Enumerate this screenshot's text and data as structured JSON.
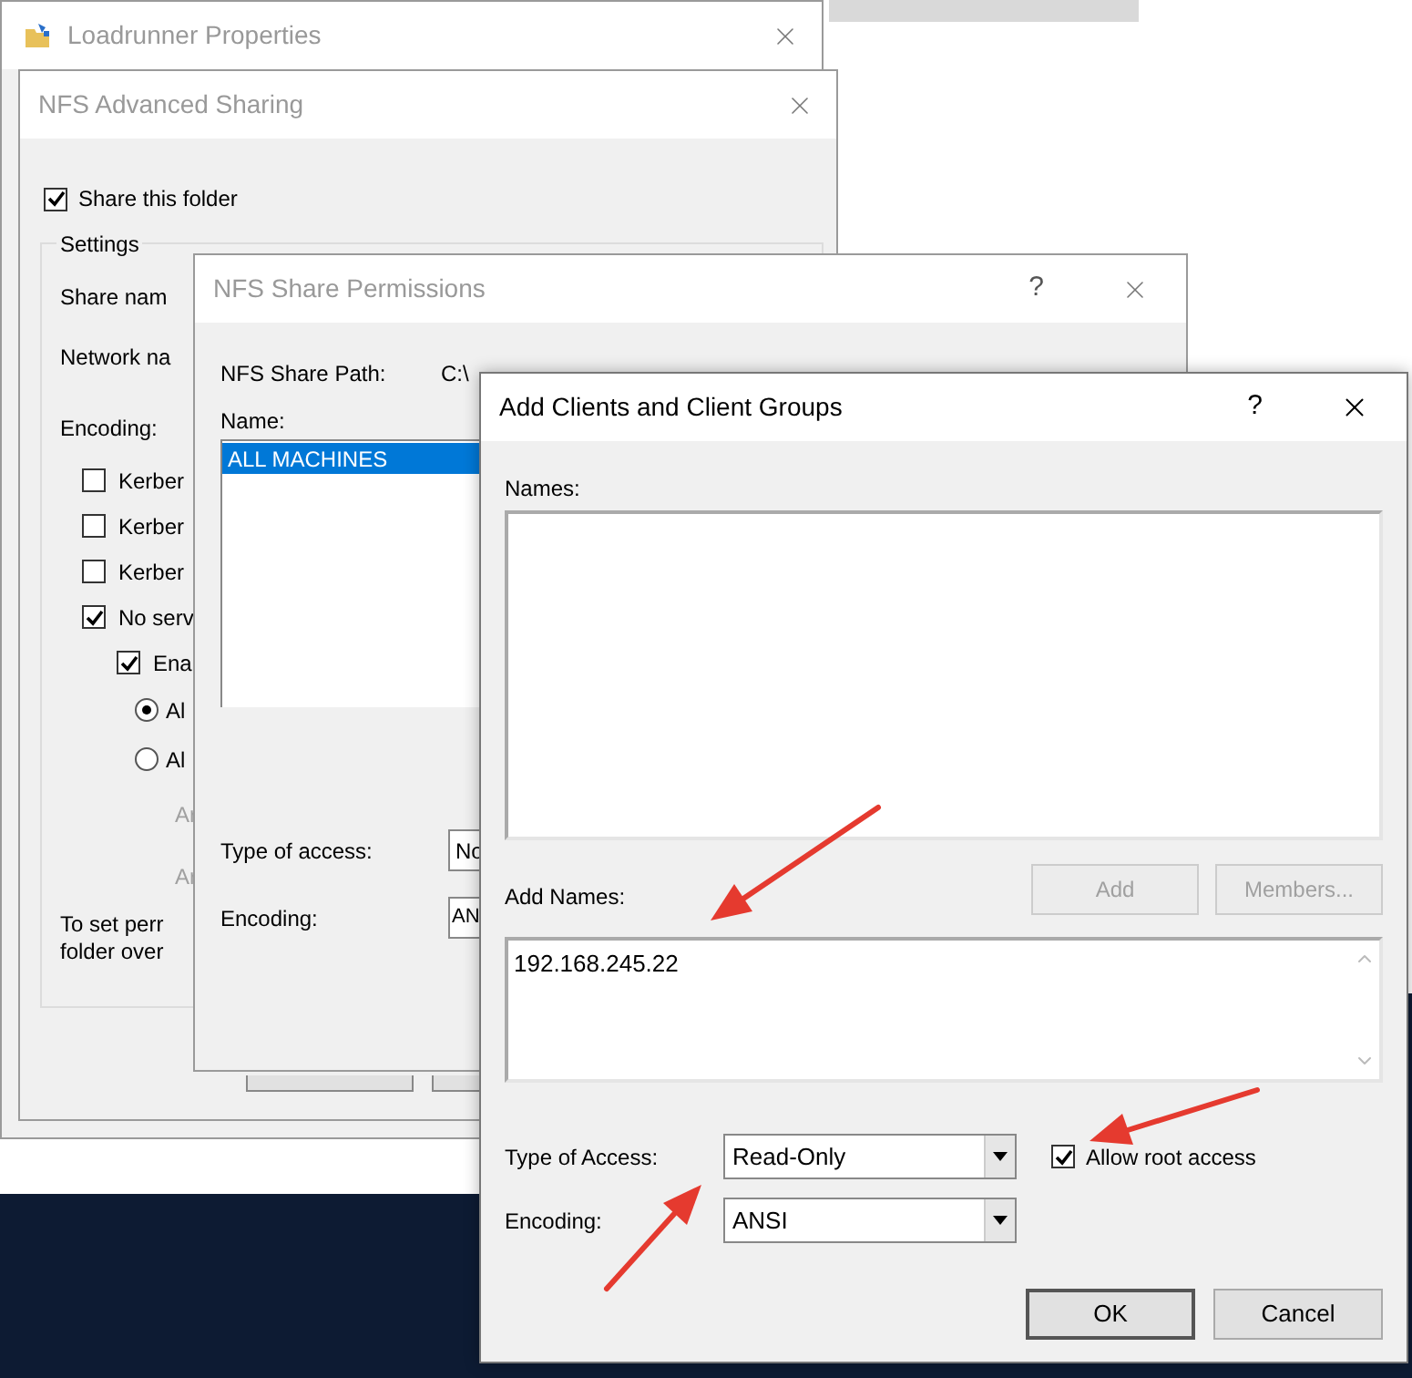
{
  "background_window": {
    "title": "Loadrunner Properties"
  },
  "advanced_sharing": {
    "title": "NFS Advanced Sharing",
    "share_folder": {
      "label": "Share this folder",
      "checked": true
    },
    "settings_label": "Settings",
    "labels": [
      "Share nam",
      "Network na",
      "Encoding:"
    ],
    "options": [
      {
        "kind": "checkbox",
        "label": "Kerber",
        "checked": false
      },
      {
        "kind": "checkbox",
        "label": "Kerber",
        "checked": false
      },
      {
        "kind": "checkbox",
        "label": "Kerber",
        "checked": false
      },
      {
        "kind": "checkbox",
        "label": "No serv",
        "checked": true,
        "children": [
          {
            "kind": "checkbox",
            "label": "Ena",
            "checked": true,
            "children": [
              {
                "kind": "radio",
                "label": "Al",
                "selected": true
              },
              {
                "kind": "radio",
                "label": "Al",
                "selected": false
              },
              {
                "kind": "text",
                "label": "Ar",
                "disabled": true
              },
              {
                "kind": "text",
                "label": "Ar",
                "disabled": true
              }
            ]
          }
        ]
      }
    ],
    "note": [
      "To set perr",
      "folder over"
    ]
  },
  "share_permissions": {
    "title": "NFS Share Permissions",
    "help": "?",
    "path_label": "NFS Share Path:",
    "path": "C:\\",
    "name_label": "Name:",
    "names": [
      {
        "label": "ALL MACHINES",
        "selected": true
      }
    ],
    "type_label": "Type of access:",
    "type_value": "No",
    "encoding_label": "Encoding:",
    "encoding_value": "AN"
  },
  "add_clients": {
    "title": "Add Clients and Client Groups",
    "help": "?",
    "names_label": "Names:",
    "buttons": [
      {
        "label": "Add",
        "disabled": true
      },
      {
        "label": "Members...",
        "disabled": true
      }
    ],
    "add_names_label": "Add Names:",
    "add_names_value": "192.168.245.22",
    "type_label": "Type of Access:",
    "type_value": "Read-Only",
    "root_access": {
      "label": "Allow root access",
      "checked": true
    },
    "encoding_label": "Encoding:",
    "encoding_value": "ANSI",
    "footer_buttons": [
      {
        "label": "OK",
        "default": true
      },
      {
        "label": "Cancel",
        "default": false
      }
    ]
  }
}
